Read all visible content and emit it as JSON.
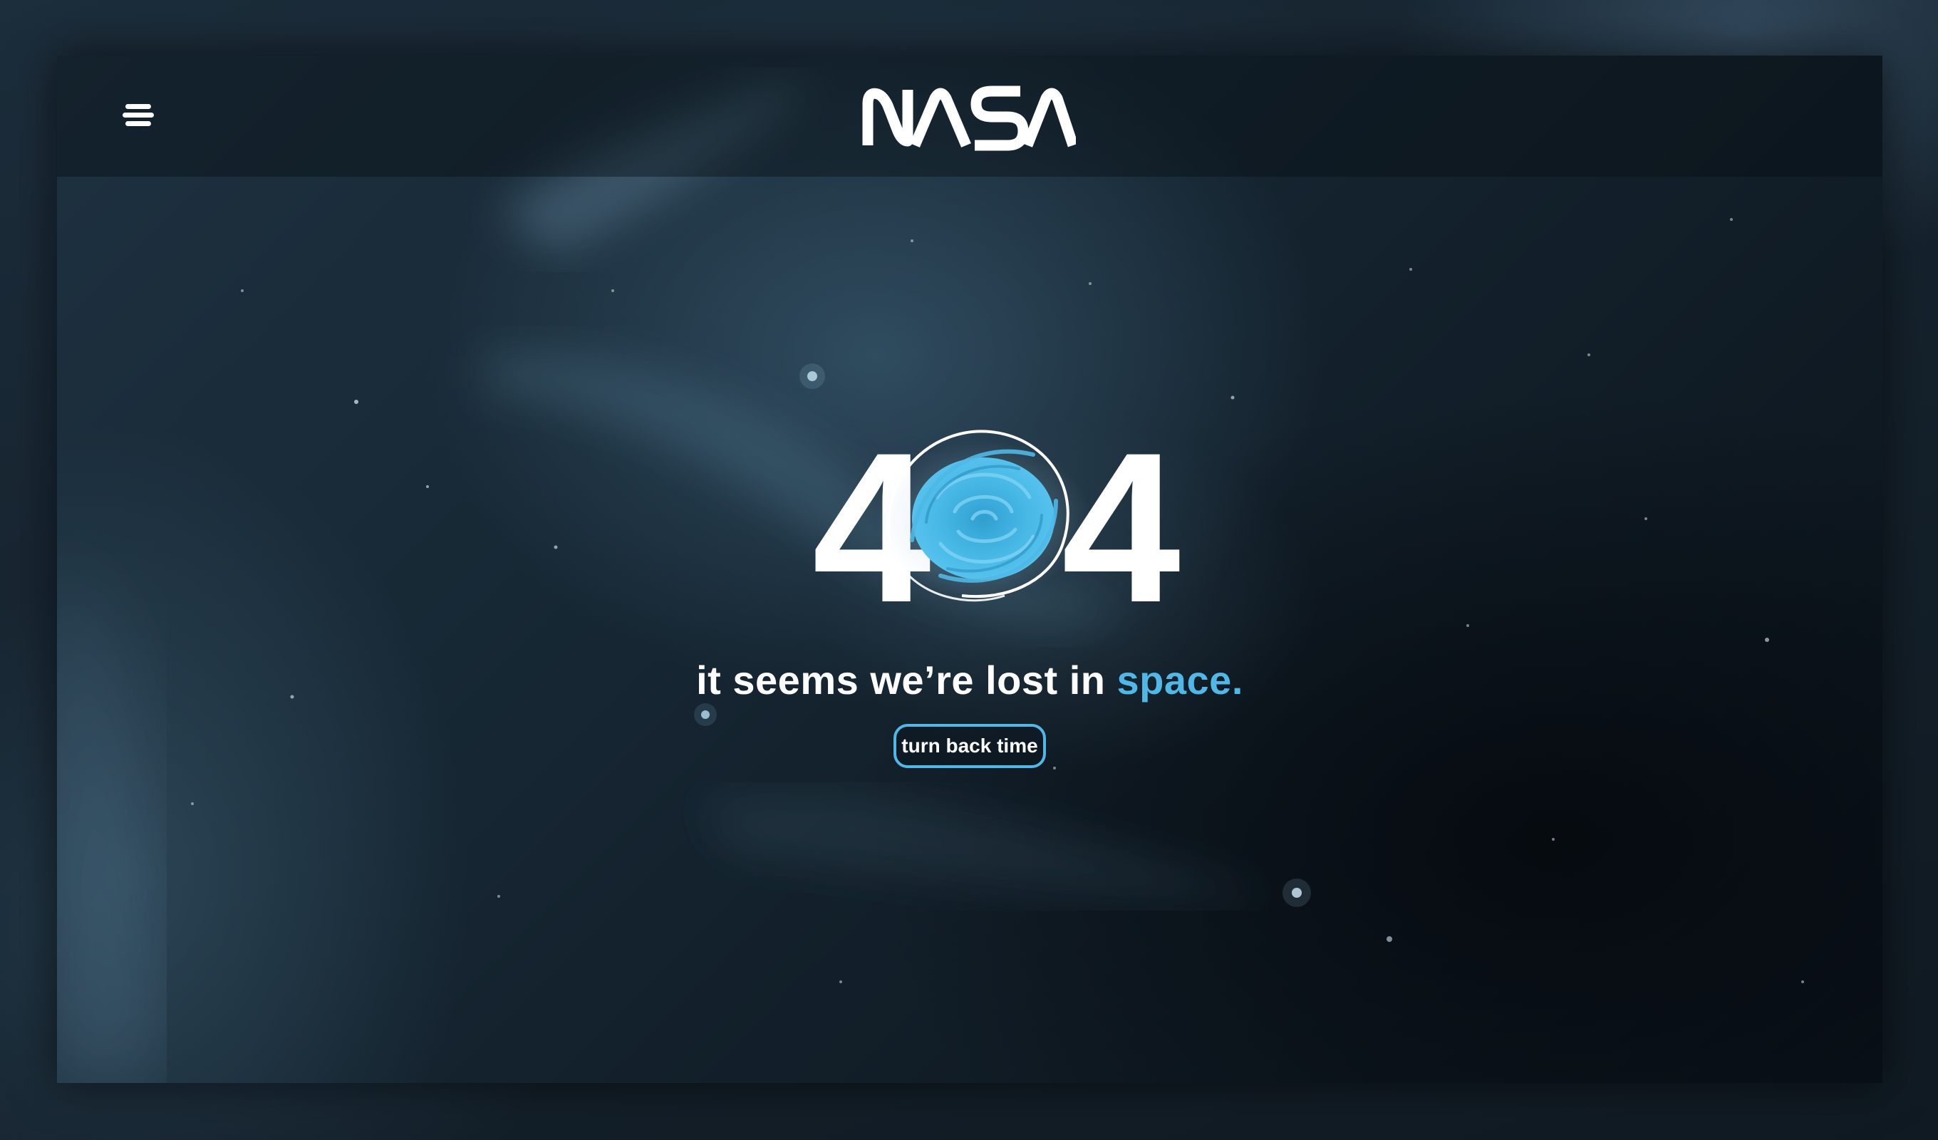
{
  "header": {
    "logo_text": "NASA",
    "menu_icon": "hamburger-menu-icon"
  },
  "error": {
    "digit_left": "4",
    "digit_right": "4",
    "center_icon": "black-hole-vortex-icon"
  },
  "tagline": {
    "text": "it seems we’re lost in ",
    "accent": "space."
  },
  "cta": {
    "label": "turn back time"
  },
  "colors": {
    "accent": "#4fb8e6",
    "text": "#ffffff",
    "background": "#172835"
  }
}
